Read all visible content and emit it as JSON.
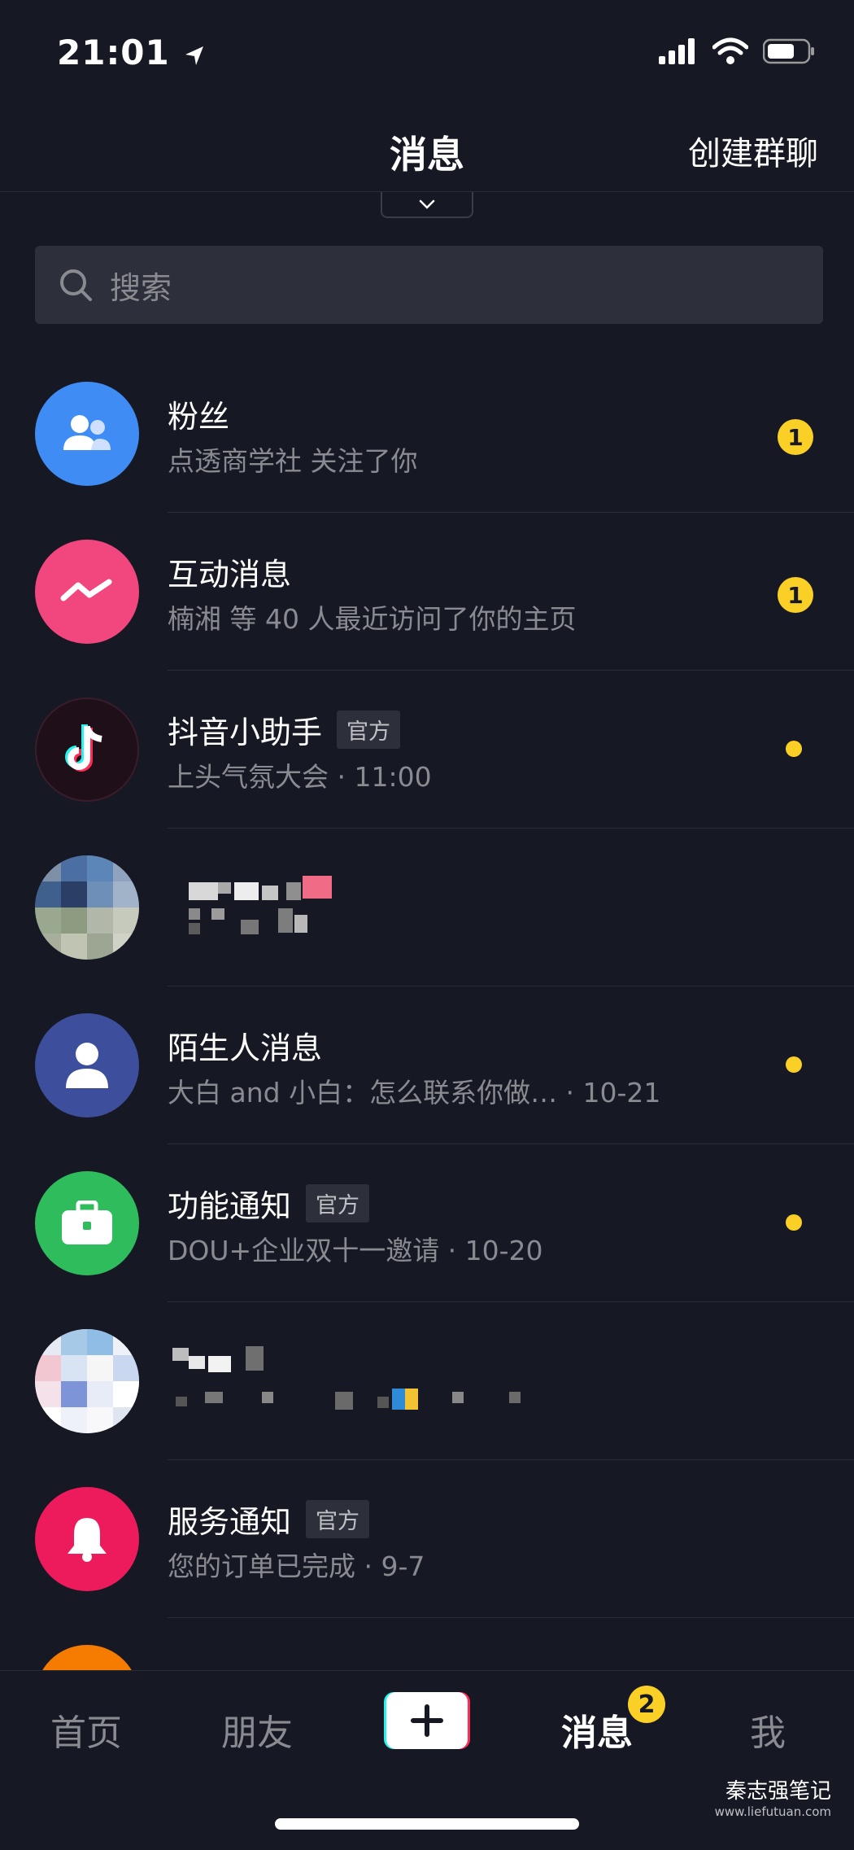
{
  "status_bar": {
    "time": "21:01"
  },
  "header": {
    "title": "消息",
    "action": "创建群聊"
  },
  "search": {
    "placeholder": "搜索"
  },
  "messages": [
    {
      "title": "粉丝",
      "subtitle": "点透商学社 关注了你",
      "badge": "1",
      "avatar_icon": "fans-icon",
      "avatar_color": "#3f8cf5"
    },
    {
      "title": "互动消息",
      "subtitle": "楠湘 等 40 人最近访问了你的主页",
      "badge": "1",
      "avatar_icon": "interaction-icon",
      "avatar_color": "#f2467f"
    },
    {
      "title": "抖音小助手",
      "tag": "官方",
      "subtitle": "上头气氛大会 · 11:00",
      "avatar_icon": "tiktok-logo-icon",
      "avatar_color": "#2a1320"
    },
    {
      "avatar_icon": "blurred-avatar"
    },
    {
      "title": "陌生人消息",
      "subtitle": "大白 and 小白：怎么联系你做… · 10-21",
      "avatar_icon": "person-icon",
      "avatar_color": "#3d4e9c"
    },
    {
      "title": "功能通知",
      "tag": "官方",
      "subtitle": "DOU+企业双十一邀请 · 10-20",
      "avatar_icon": "toolbox-icon",
      "avatar_color": "#2ebc5c"
    },
    {
      "avatar_icon": "blurred-avatar"
    },
    {
      "title": "服务通知",
      "tag": "官方",
      "subtitle": "您的订单已完成 · 9-7",
      "avatar_icon": "bell-icon",
      "avatar_color": "#ed1b5c"
    }
  ],
  "bottom_nav": {
    "items": [
      "首页",
      "朋友",
      "消息",
      "我"
    ],
    "active": "消息",
    "message_badge": "2"
  },
  "watermark": {
    "name": "秦志强笔记",
    "url": "www.liefutuan.com"
  },
  "colors": {
    "background": "#161823",
    "badge": "#facf26"
  }
}
